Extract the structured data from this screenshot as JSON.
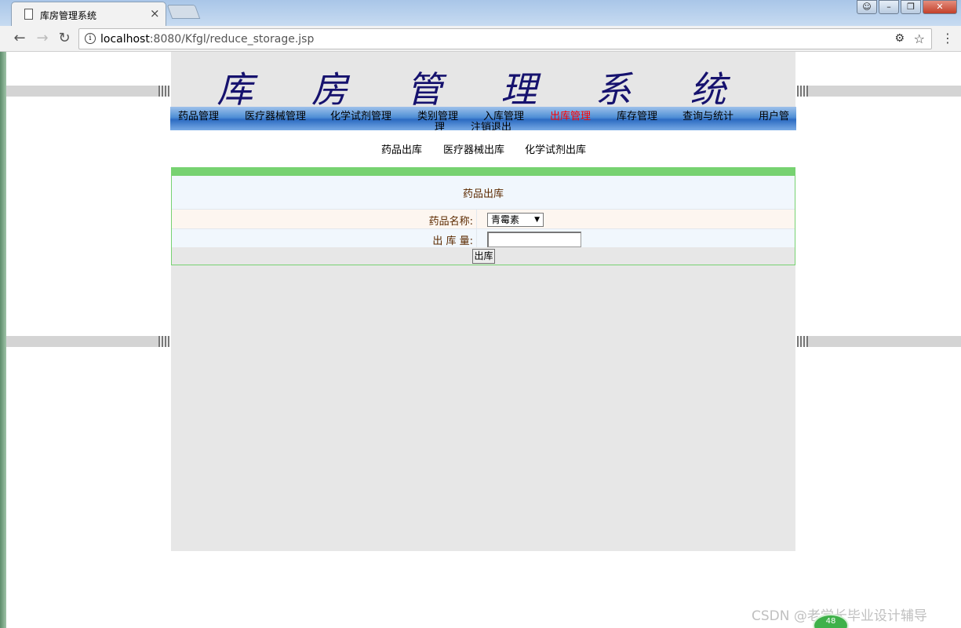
{
  "browser": {
    "tab_title": "库房管理系统",
    "tab_close": "×",
    "url_host": "localhost",
    "url_path": ":8080/Kfgl/reduce_storage.jsp",
    "window_controls": [
      "person-icon",
      "minimize-icon",
      "restore-icon",
      "close-icon"
    ]
  },
  "header": {
    "title": "库 房 管 理 系 统"
  },
  "nav": {
    "items": [
      {
        "label": "药品管理"
      },
      {
        "label": "医疗器械管理"
      },
      {
        "label": "化学试剂管理"
      },
      {
        "label": "类别管理"
      },
      {
        "label": "入库管理"
      },
      {
        "label": "出库管理",
        "active": true
      },
      {
        "label": "库存管理"
      },
      {
        "label": "查询与统计"
      },
      {
        "label": "用户管"
      },
      {
        "label": "理"
      },
      {
        "label": "注销退出"
      }
    ],
    "active_color": "#ff0000"
  },
  "subnav": {
    "items": [
      {
        "label": "药品出库"
      },
      {
        "label": "医疗器械出库"
      },
      {
        "label": "化学试剂出库"
      }
    ]
  },
  "form": {
    "title": "药品出库",
    "name_label": "药品名称:",
    "name_value": "青霉素",
    "qty_label": "出 库 量:",
    "qty_value": "",
    "submit_label": "出库",
    "accent_color": "#77d271"
  },
  "watermark": {
    "text": "CSDN @老学长毕业设计辅导",
    "badge": "48"
  }
}
